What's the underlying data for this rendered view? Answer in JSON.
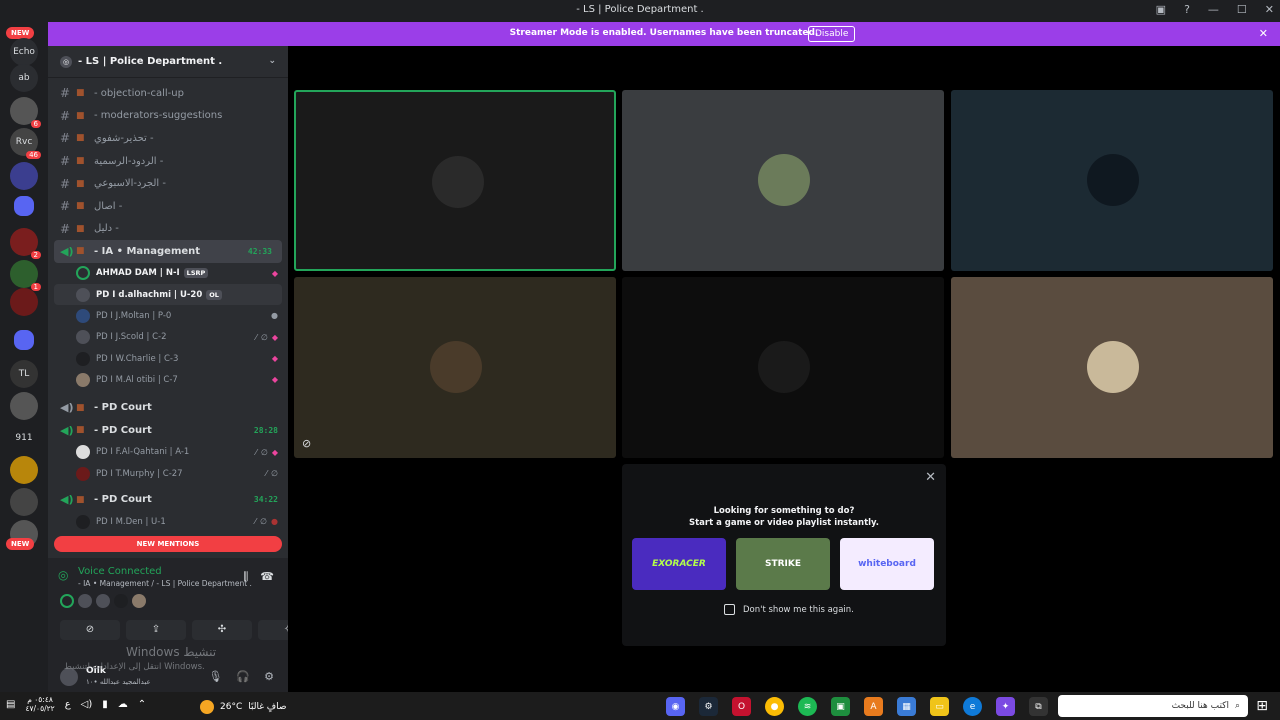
{
  "window": {
    "title": "- LS | Police Department ."
  },
  "banner": {
    "message": "Streamer Mode is enabled. Usernames have been truncated.",
    "button": "Disable"
  },
  "guilds": {
    "new_top": "NEW",
    "new_bottom": "NEW",
    "items": [
      {
        "label": "Echo",
        "badge": ""
      },
      {
        "label": "ab",
        "badge": ""
      },
      {
        "label": "",
        "badge": "6"
      },
      {
        "label": "Rvc",
        "badge": "46"
      },
      {
        "label": "",
        "badge": ""
      },
      {
        "label": "",
        "badge": ""
      },
      {
        "label": "",
        "badge": "2"
      },
      {
        "label": "",
        "badge": "1"
      },
      {
        "label": "",
        "badge": ""
      },
      {
        "label": "",
        "badge": ""
      },
      {
        "label": "",
        "badge": ""
      },
      {
        "label": "",
        "badge": ""
      },
      {
        "label": "911",
        "badge": ""
      },
      {
        "label": "",
        "badge": ""
      },
      {
        "label": "",
        "badge": ""
      },
      {
        "label": "",
        "badge": ""
      }
    ]
  },
  "server": {
    "name": "- LS | Police Department ."
  },
  "channels": [
    {
      "name": "- objection-call-up"
    },
    {
      "name": "- moderators-suggestions"
    },
    {
      "name": "تحذير-شفوي -"
    },
    {
      "name": "الردود-الرسمية -"
    },
    {
      "name": "الجرد-الاسبوعي -"
    },
    {
      "name": "اصال -"
    },
    {
      "name": "دليل -"
    }
  ],
  "voice_management": {
    "name": "- IA • Management",
    "timer": "42:33"
  },
  "management_users": [
    {
      "name": "AHMAD DAM | N-I",
      "tag": "LSRP"
    },
    {
      "name": "PD I d.alhachmi | U-20",
      "tag": "OL"
    },
    {
      "name": "PD I J.Moltan | P-0",
      "tag": ""
    },
    {
      "name": "PD I J.Scold | C-2",
      "tag": ""
    },
    {
      "name": "PD I W.Charlie | C-3",
      "tag": ""
    },
    {
      "name": "PD I M.Al otibi | C-7",
      "tag": ""
    }
  ],
  "court1": {
    "name": "- PD Court"
  },
  "court2": {
    "name": "- PD Court",
    "timer": "28:28"
  },
  "court2_users": [
    {
      "name": "PD I F.Al-Qahtani | A-1"
    },
    {
      "name": "PD I T.Murphy | C-27"
    }
  ],
  "court3": {
    "name": "- PD Court",
    "timer": "34:22"
  },
  "court3_users": [
    {
      "name": "PD I M.Den | U-1"
    }
  ],
  "new_mentions": "NEW MENTIONS",
  "voice_panel": {
    "title": "Voice Connected",
    "subtitle": "- IA • Management / - LS | Police Department ."
  },
  "watermark": {
    "line1": "Windows تنشيط",
    "line2": "انتقل إلى الإعدادات لتنشيط Windows."
  },
  "user_panel": {
    "name": "Oilk",
    "status": "عبدالمجيد عبدالله •١٠"
  },
  "activity": {
    "heading": "Looking for something to do?",
    "subheading": "Start a game or video playlist instantly.",
    "cards": [
      "EXORACER",
      "STRIKE",
      "whiteboard"
    ],
    "checkbox_label": "Don't show me this again."
  },
  "taskbar": {
    "time": "٠٥:٤٨ م",
    "date": "٤٧/٠٥/٢٢",
    "temperature": "26°C",
    "weather_text": "صافٍ غالبًا",
    "search_placeholder": "اكتب هنا للبحث",
    "lang": "ع"
  },
  "colors": {
    "accent": "#23a55a",
    "banner": "#9b3ee8",
    "mention": "#f23f43"
  }
}
